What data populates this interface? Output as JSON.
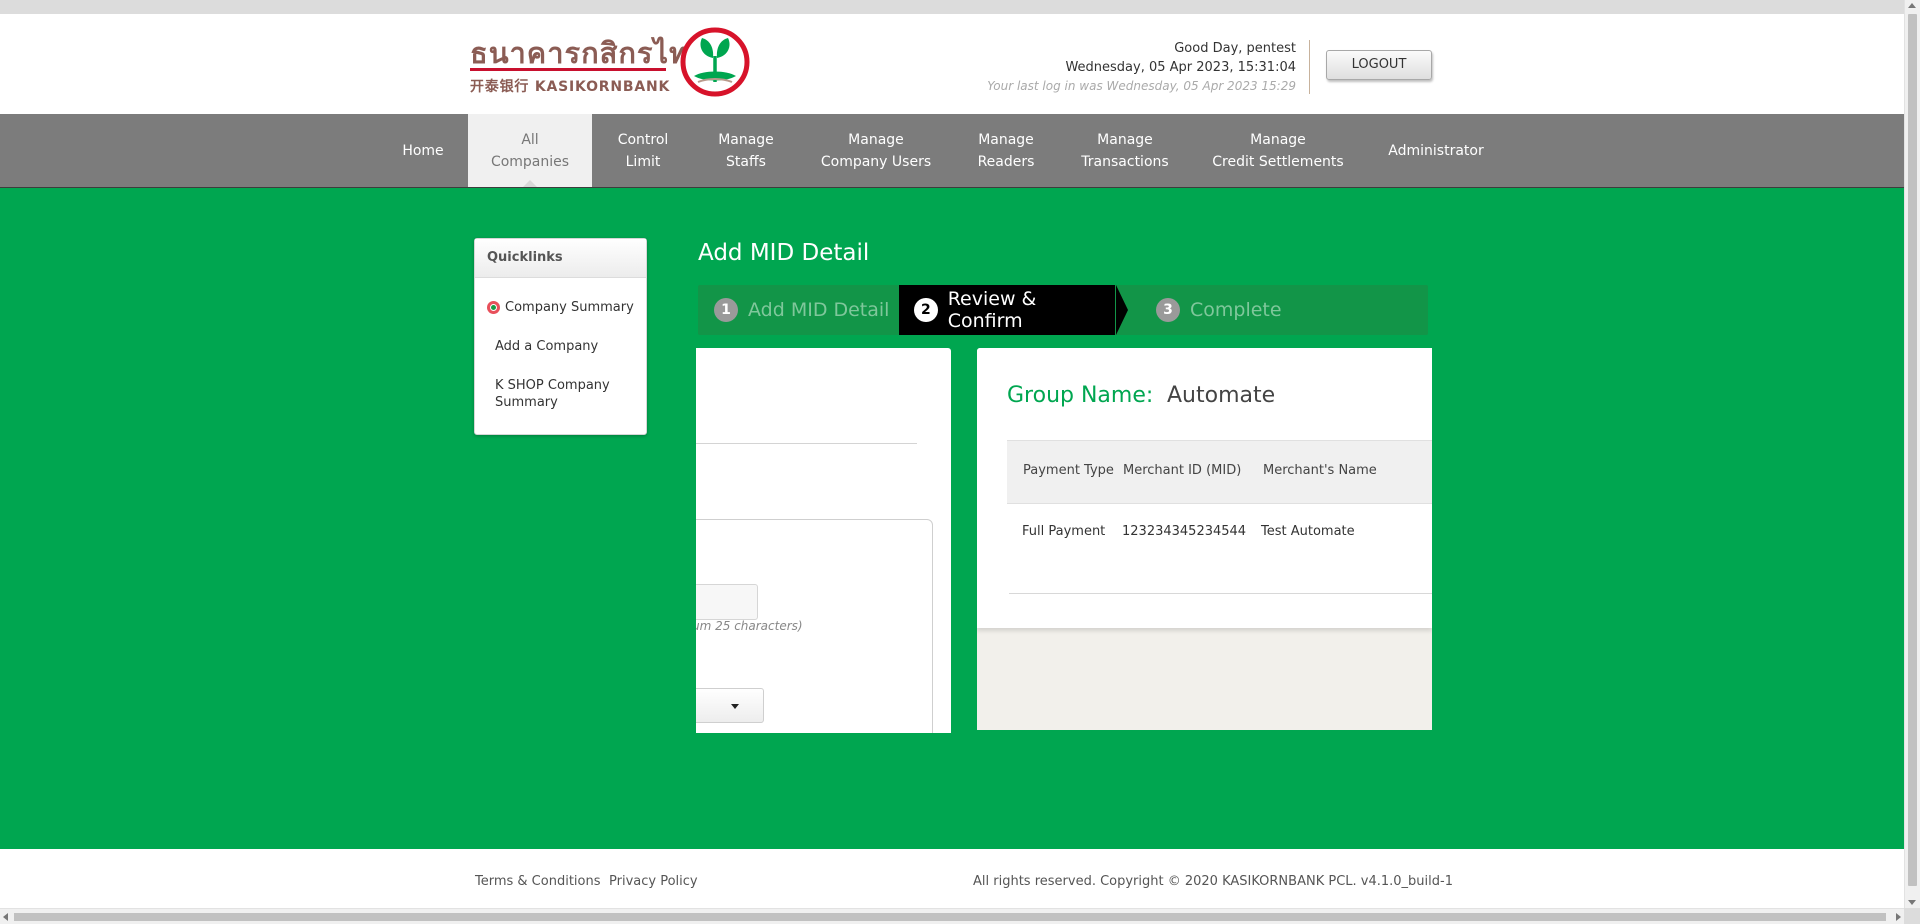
{
  "header": {
    "logo_thai": "ธนาคารกสิกรไทย",
    "logo_english": "开泰银行 KASIKORNBANK",
    "greeting": "Good Day, pentest",
    "datetime": "Wednesday, 05 Apr 2023, 15:31:04",
    "last_login": "Your last log in was Wednesday, 05 Apr 2023 15:29",
    "logout_label": "LOGOUT"
  },
  "nav": {
    "items": [
      {
        "label": "Home"
      },
      {
        "label": "All\nCompanies",
        "active": true
      },
      {
        "label": "Control\nLimit"
      },
      {
        "label": "Manage\nStaffs"
      },
      {
        "label": "Manage\nCompany Users"
      },
      {
        "label": "Manage\nReaders"
      },
      {
        "label": "Manage\nTransactions"
      },
      {
        "label": "Manage\nCredit Settlements"
      },
      {
        "label": "Administrator"
      }
    ]
  },
  "quicklinks": {
    "title": "Quicklinks",
    "items": [
      {
        "label": "Company Summary",
        "icon": "kbank-bullet-icon"
      },
      {
        "label": "Add a Company"
      },
      {
        "label": "K SHOP Company Summary"
      }
    ]
  },
  "page": {
    "title": "Add MID Detail"
  },
  "steps": [
    {
      "num": "1",
      "label": "Add MID Detail",
      "state": "done"
    },
    {
      "num": "2",
      "label": "Review & Confirm",
      "state": "active"
    },
    {
      "num": "3",
      "label": "Complete",
      "state": "pending"
    }
  ],
  "left_panel": {
    "hint": "um 25 characters)"
  },
  "review": {
    "group_label": "Group Name:",
    "group_value": "Automate",
    "columns": [
      "Payment Type",
      "Merchant ID (MID)",
      "Merchant's Name"
    ],
    "rows": [
      [
        "Full Payment",
        "123234345234544",
        "Test Automate"
      ]
    ]
  },
  "footer": {
    "terms": "Terms & Conditions",
    "privacy": "Privacy Policy",
    "copyright": "All rights reserved. Copyright © 2020 KASIKORNBANK PCL.  v4.1.0_build-1"
  },
  "colors": {
    "brand_green": "#00a650",
    "nav_gray": "#7c7c7c",
    "active_step": "#000000"
  }
}
